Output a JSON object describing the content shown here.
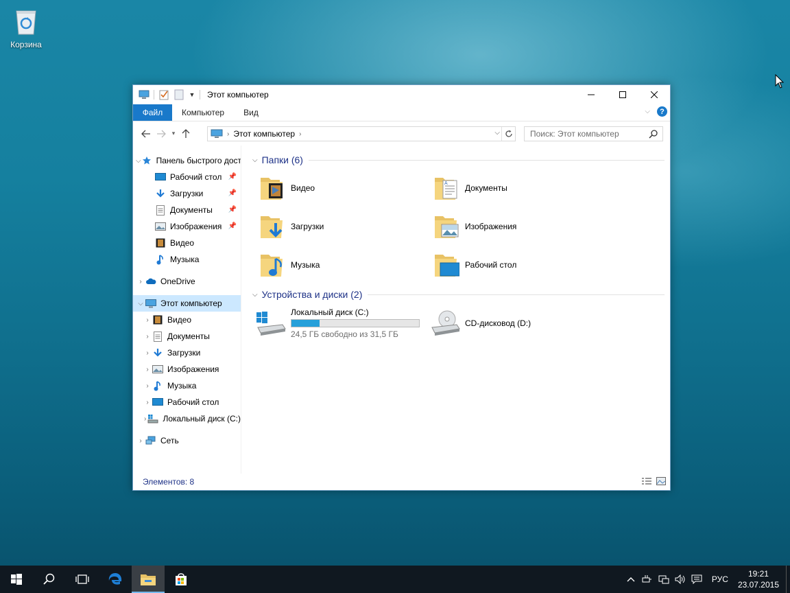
{
  "desktop": {
    "recycle_bin_label": "Корзина"
  },
  "window": {
    "title": "Этот компьютер",
    "controls": {
      "minimize": "—",
      "maximize": "☐",
      "close": "✕"
    }
  },
  "ribbon": {
    "tabs": [
      {
        "label": "Файл"
      },
      {
        "label": "Компьютер"
      },
      {
        "label": "Вид"
      }
    ],
    "help": "?"
  },
  "navigation": {
    "back": "←",
    "forward": "→",
    "recent": "⌄",
    "up": "↑",
    "address": {
      "crumb": "Этот компьютер",
      "separator": "›"
    },
    "search": {
      "placeholder": "Поиск: Этот компьютер"
    }
  },
  "sidebar": {
    "quick_access": {
      "label": "Панель быстрого доступа",
      "items": [
        {
          "label": "Рабочий стол",
          "icon": "desktop-icon",
          "pinned": true
        },
        {
          "label": "Загрузки",
          "icon": "downloads-icon",
          "pinned": true
        },
        {
          "label": "Документы",
          "icon": "documents-icon",
          "pinned": true
        },
        {
          "label": "Изображения",
          "icon": "pictures-icon",
          "pinned": true
        },
        {
          "label": "Видео",
          "icon": "videos-icon",
          "pinned": false
        },
        {
          "label": "Музыка",
          "icon": "music-icon",
          "pinned": false
        }
      ]
    },
    "onedrive": {
      "label": "OneDrive"
    },
    "this_pc": {
      "label": "Этот компьютер",
      "items": [
        {
          "label": "Видео",
          "icon": "videos-icon"
        },
        {
          "label": "Документы",
          "icon": "documents-icon"
        },
        {
          "label": "Загрузки",
          "icon": "downloads-icon"
        },
        {
          "label": "Изображения",
          "icon": "pictures-icon"
        },
        {
          "label": "Музыка",
          "icon": "music-icon"
        },
        {
          "label": "Рабочий стол",
          "icon": "desktop-icon"
        },
        {
          "label": "Локальный диск (C:)",
          "icon": "local-disk-icon"
        }
      ]
    },
    "network": {
      "label": "Сеть"
    }
  },
  "main": {
    "folders_group": {
      "title": "Папки (6)",
      "items": [
        {
          "label": "Видео",
          "icon": "videos-folder-icon"
        },
        {
          "label": "Документы",
          "icon": "documents-folder-icon"
        },
        {
          "label": "Загрузки",
          "icon": "downloads-folder-icon"
        },
        {
          "label": "Изображения",
          "icon": "pictures-folder-icon"
        },
        {
          "label": "Музыка",
          "icon": "music-folder-icon"
        },
        {
          "label": "Рабочий стол",
          "icon": "desktop-folder-icon"
        }
      ]
    },
    "devices_group": {
      "title": "Устройства и диски (2)",
      "drives": [
        {
          "label": "Локальный диск (C:)",
          "free": "24,5 ГБ свободно из 31,5 ГБ",
          "used_fraction": 0.222
        },
        {
          "label": "CD-дисковод (D:)"
        }
      ]
    }
  },
  "status": {
    "items": "Элементов: 8"
  },
  "taskbar": {
    "tray": {
      "language": "РУС",
      "time": "19:21",
      "date": "23.07.2015"
    }
  },
  "colors": {
    "accent": "#1979ca",
    "group_title": "#1e3287",
    "selection": "#cce8ff",
    "progress": "#26a0da"
  }
}
